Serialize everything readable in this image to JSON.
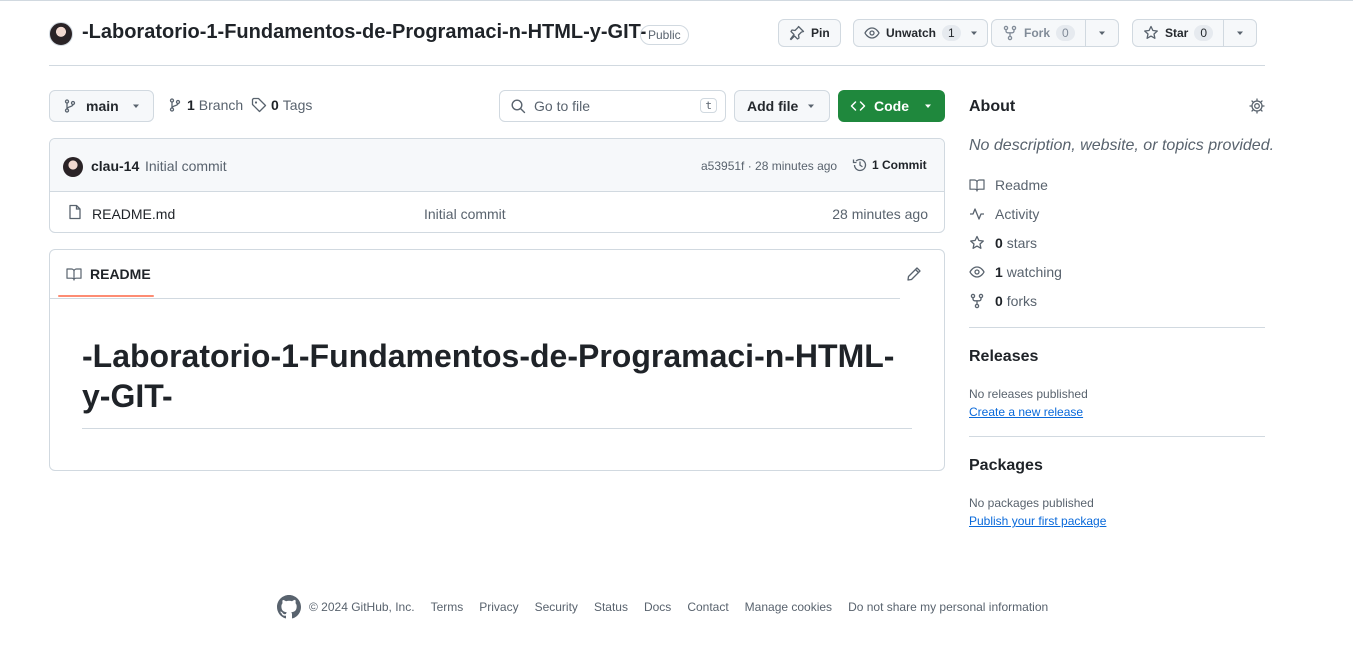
{
  "repo": {
    "name": "-Laboratorio-1-Fundamentos-de-Programaci-n-HTML-y-GIT-",
    "visibility": "Public"
  },
  "header_actions": {
    "pin": "Pin",
    "unwatch": "Unwatch",
    "watch_count": "1",
    "fork": "Fork",
    "fork_count": "0",
    "star": "Star",
    "star_count": "0"
  },
  "toolbar": {
    "branch": "main",
    "branches_count": "1",
    "branches_label": "Branch",
    "tags_count": "0",
    "tags_label": "Tags",
    "search_placeholder": "Go to file",
    "search_shortcut": "t",
    "add_file": "Add file",
    "code": "Code"
  },
  "latest_commit": {
    "author": "clau-14",
    "message": "Initial commit",
    "meta": "a53951f · 28 minutes ago",
    "commits": "1 Commit"
  },
  "files": [
    {
      "name": "README.md",
      "message": "Initial commit",
      "time": "28 minutes ago"
    }
  ],
  "readme": {
    "tab": "README",
    "heading": "-Laboratorio-1-Fundamentos-de-Programaci-n-HTML-y-GIT-"
  },
  "about": {
    "title": "About",
    "description": "No description, website, or topics provided.",
    "items": [
      {
        "icon": "book-icon",
        "count": "",
        "label": "Readme"
      },
      {
        "icon": "activity-icon",
        "count": "",
        "label": "Activity"
      },
      {
        "icon": "star-icon",
        "count": "0",
        "label": "stars"
      },
      {
        "icon": "eye-icon",
        "count": "1",
        "label": "watching"
      },
      {
        "icon": "fork-icon",
        "count": "0",
        "label": "forks"
      }
    ]
  },
  "releases": {
    "title": "Releases",
    "empty": "No releases published",
    "link": "Create a new release"
  },
  "packages": {
    "title": "Packages",
    "empty": "No packages published",
    "link": "Publish your first package"
  },
  "footer": {
    "copyright": "© 2024 GitHub, Inc.",
    "links": [
      "Terms",
      "Privacy",
      "Security",
      "Status",
      "Docs",
      "Contact",
      "Manage cookies",
      "Do not share my personal information"
    ]
  },
  "colors": {
    "primary_button": "#1f883d",
    "link": "#0969da",
    "tab_underline": "#fd8c73",
    "border": "#d1d9e0"
  }
}
